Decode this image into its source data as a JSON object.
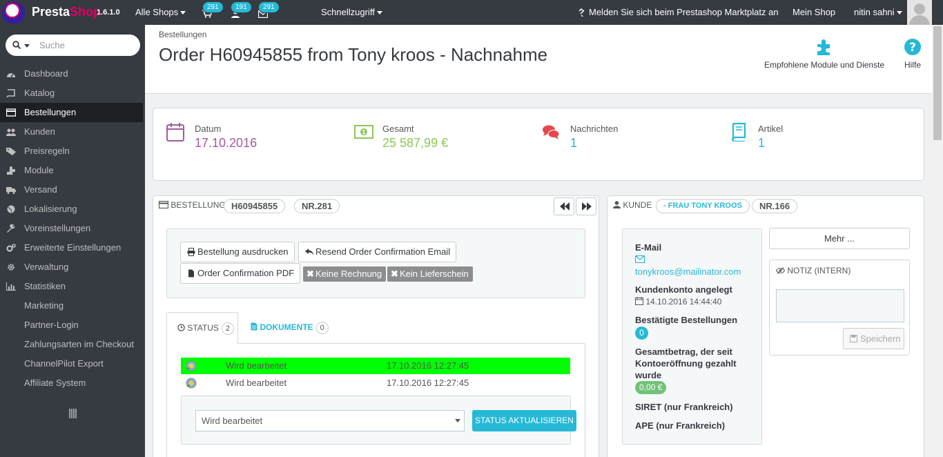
{
  "colors": {
    "topbar": "#363a41",
    "accent": "#25b9d7",
    "date_purple": "#a4599f",
    "total_green": "#8bc954",
    "messages_red": "#e5474c",
    "highlight_green": "#00ff00"
  },
  "topbar": {
    "logo_presta": "Presta",
    "logo_shop": "Shop",
    "version": "1.6.1.0",
    "shops_label": "Alle Shops",
    "orders_badge": "291",
    "customers_badge": "191",
    "messages_badge": "291",
    "quick_access": "Schnellzugriff",
    "marketplace": "Melden Sie sich beim Prestashop Marktplatz an",
    "my_shop": "Mein Shop",
    "user": "nitin sahni"
  },
  "sidebar": {
    "search_placeholder": "Suche",
    "items": [
      {
        "label": "Dashboard",
        "icon": "dashboard-icon"
      },
      {
        "label": "Katalog",
        "icon": "book-icon"
      },
      {
        "label": "Bestellungen",
        "icon": "credit-card-icon"
      },
      {
        "label": "Kunden",
        "icon": "users-icon"
      },
      {
        "label": "Preisregeln",
        "icon": "tag-icon"
      },
      {
        "label": "Module",
        "icon": "puzzle-icon"
      },
      {
        "label": "Versand",
        "icon": "truck-icon"
      },
      {
        "label": "Lokalisierung",
        "icon": "globe-icon"
      },
      {
        "label": "Voreinstellungen",
        "icon": "wrench-icon"
      },
      {
        "label": "Erweiterte Einstellungen",
        "icon": "cogs-icon"
      },
      {
        "label": "Verwaltung",
        "icon": "cog-icon"
      },
      {
        "label": "Statistiken",
        "icon": "bar-chart-icon"
      },
      {
        "label": "Marketing",
        "icon": ""
      },
      {
        "label": "Partner-Login",
        "icon": ""
      },
      {
        "label": "Zahlungsarten im Checkout",
        "icon": ""
      },
      {
        "label": "ChannelPilot Export",
        "icon": ""
      },
      {
        "label": "Affiliate System",
        "icon": ""
      }
    ]
  },
  "header": {
    "breadcrumb": "Bestellungen",
    "title": "Order H60945855 from Tony kroos - Nachnahme",
    "modules_label": "Empfohlene Module und Dienste",
    "help_label": "Hilfe"
  },
  "kpis": {
    "date": {
      "label": "Datum",
      "value": "17.10.2016"
    },
    "total": {
      "label": "Gesamt",
      "value": "25 587,99 €"
    },
    "messages": {
      "label": "Nachrichten",
      "value": "1"
    },
    "products": {
      "label": "Artikel",
      "value": "1"
    }
  },
  "order": {
    "heading": "Bestellung",
    "reference": "H60945855",
    "number": "NR.281",
    "print_button": "Bestellung ausdrucken",
    "resend_button": "Resend Order Confirmation Email",
    "pdf_button": "Order Confirmation PDF",
    "no_invoice": "Keine Rechnung",
    "no_delivery": "Kein Lieferschein",
    "tab_status": "Status",
    "tab_status_count": "2",
    "tab_documents": "Dokumente",
    "tab_documents_count": "0",
    "history": [
      {
        "status": "Wird bearbeitet",
        "date": "17.10.2016 12:27:45"
      },
      {
        "status": "Wird bearbeitet",
        "date": "17.10.2016 12:27:45"
      }
    ],
    "status_select": "Wird bearbeitet",
    "update_button": "STATUS AKTUALISIEREN"
  },
  "customer": {
    "heading": "Kunde",
    "name": "- FRAU TONY KROOS",
    "number": "NR.166",
    "email_label": "E-Mail",
    "email": "tonykroos@mailinator.com",
    "account_label": "Kundenkonto angelegt",
    "account_date": "14.10.2016 14:44:40",
    "valid_orders_label": "Bestätigte Bestellungen",
    "valid_orders": "0",
    "total_spent_label_1": "Gesamtbetrag, der seit",
    "total_spent_label_2": "Kontoeröffnung gezahlt",
    "total_spent_label_3": "wurde",
    "total_spent": "0,00 €",
    "siret_label": "SIRET (nur Frankreich)",
    "ape_label": "APE (nur Frankreich)",
    "more_button": "Mehr ...",
    "note_heading": "NOTIZ (INTERN)",
    "save_button": "Speichern"
  }
}
